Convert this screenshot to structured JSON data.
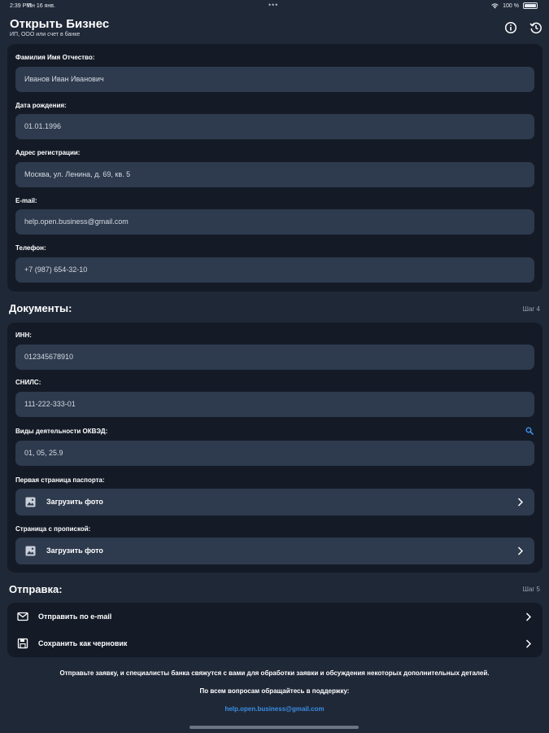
{
  "status_bar": {
    "time": "2:39 PM",
    "date": "Пн 16 янв.",
    "dots": "•••",
    "battery": "100 %"
  },
  "nav": {
    "title": "Открыть Бизнес",
    "subtitle": "ИП, ООО или счет в банке",
    "info_icon": "info-icon",
    "history_icon": "history-icon"
  },
  "personal": {
    "fio_label": "Фамилия Имя Отчество:",
    "fio_value": "Иванов Иван Иванович",
    "birth_label": "Дата рождения:",
    "birth_value": "01.01.1996",
    "address_label": "Адрес регистрации:",
    "address_value": "Москва, ул. Ленина, д. 69, кв. 5",
    "email_label": "E-mail:",
    "email_value": "help.open.business@gmail.com",
    "phone_label": "Телефон:",
    "phone_value": "+7 (987) 654-32-10"
  },
  "documents": {
    "title": "Документы:",
    "step": "Шаг 4",
    "inn_label": "ИНН:",
    "inn_value": "012345678910",
    "snils_label": "СНИЛС:",
    "snils_value": "111-222-333-01",
    "okved_label": "Виды деятельности ОКВЭД:",
    "okved_value": "01, 05, 25.9",
    "passport_label": "Первая страница паспорта:",
    "passport_button": "Загрузить фото",
    "registration_label": "Страница с пропиской:",
    "registration_button": "Загрузить фото"
  },
  "submit": {
    "title": "Отправка:",
    "step": "Шаг 5",
    "email_action": "Отправить по e-mail",
    "draft_action": "Сохранить как черновик"
  },
  "footer": {
    "note": "Отправьте заявку, и специалисты банка свяжутся с вами для обработки заявки и обсуждения некоторых дополнительных деталей.",
    "support": "По всем вопросам обращайтесь в поддержку:",
    "support_email": "help.open.business@gmail.com"
  },
  "colors": {
    "background": "#1f2837",
    "card": "#141b27",
    "input": "#2e3a4d",
    "link": "#3a8ee6"
  }
}
